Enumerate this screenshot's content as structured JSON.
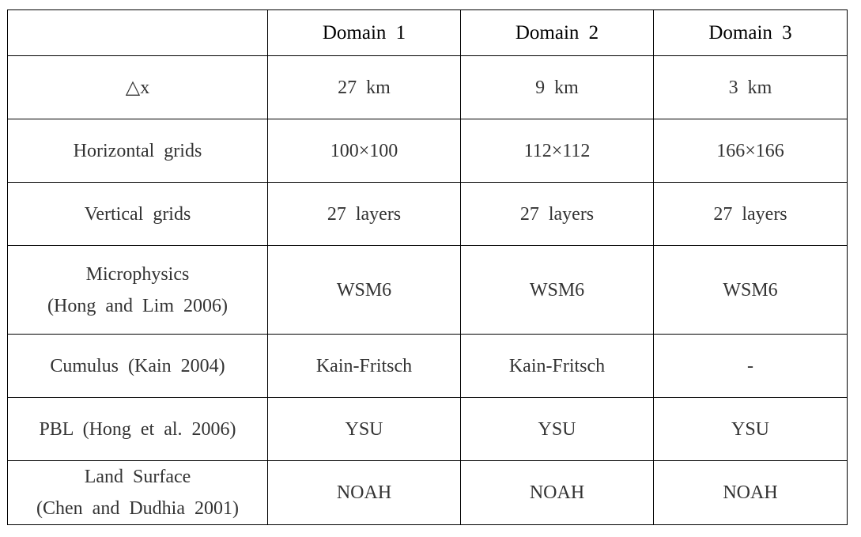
{
  "table": {
    "headers": [
      "",
      "Domain 1",
      "Domain 2",
      "Domain 3"
    ],
    "rows": [
      {
        "label": [
          "△x"
        ],
        "values": [
          "27 km",
          "9 km",
          "3 km"
        ]
      },
      {
        "label": [
          "Horizontal grids"
        ],
        "values": [
          "100×100",
          "112×112",
          "166×166"
        ]
      },
      {
        "label": [
          "Vertical grids"
        ],
        "values": [
          "27 layers",
          "27 layers",
          "27 layers"
        ]
      },
      {
        "label": [
          "Microphysics",
          "(Hong and Lim 2006)"
        ],
        "values": [
          "WSM6",
          "WSM6",
          "WSM6"
        ]
      },
      {
        "label": [
          "Cumulus (Kain 2004)"
        ],
        "values": [
          "Kain-Fritsch",
          "Kain-Fritsch",
          "-"
        ]
      },
      {
        "label": [
          "PBL (Hong et al. 2006)"
        ],
        "values": [
          "YSU",
          "YSU",
          "YSU"
        ]
      },
      {
        "label": [
          "Land Surface",
          "(Chen and Dudhia 2001)"
        ],
        "values": [
          "NOAH",
          "NOAH",
          "NOAH"
        ]
      }
    ]
  }
}
